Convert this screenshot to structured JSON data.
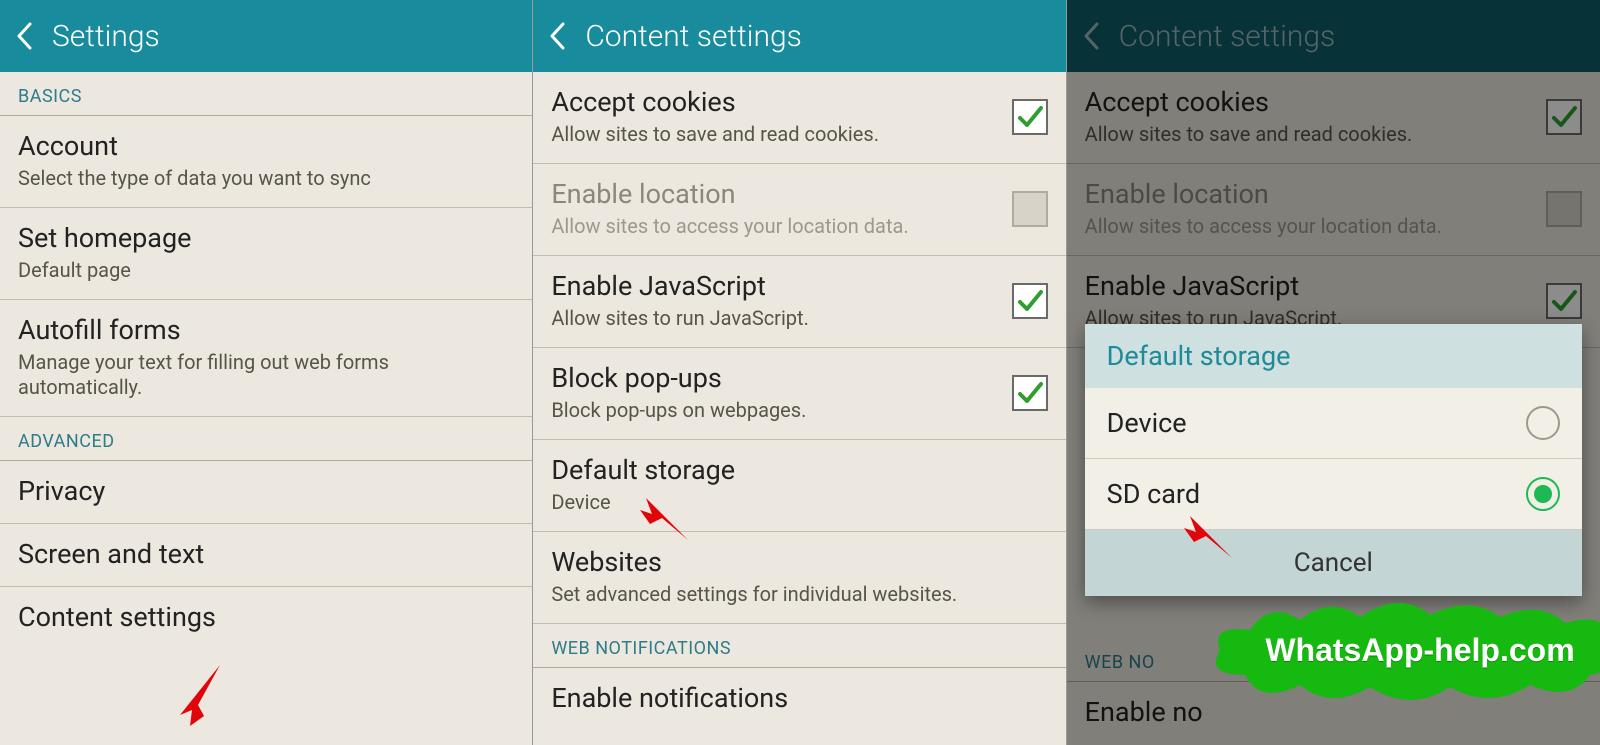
{
  "pane1": {
    "header": "Settings",
    "basics_label": "BASICS",
    "advanced_label": "ADVANCED",
    "account": {
      "title": "Account",
      "sub": "Select the type of data you want to sync"
    },
    "homepage": {
      "title": "Set homepage",
      "sub": "Default page"
    },
    "autofill": {
      "title": "Autofill forms",
      "sub": "Manage your text for filling out web forms automatically."
    },
    "privacy": {
      "title": "Privacy"
    },
    "screen_text": {
      "title": "Screen and text"
    },
    "content_settings": {
      "title": "Content settings"
    }
  },
  "pane2": {
    "header": "Content settings",
    "cookies": {
      "title": "Accept cookies",
      "sub": "Allow sites to save and read cookies.",
      "checked": true
    },
    "location": {
      "title": "Enable location",
      "sub": "Allow sites to access your location data.",
      "checked": false,
      "disabled": true
    },
    "js": {
      "title": "Enable JavaScript",
      "sub": "Allow sites to run JavaScript.",
      "checked": true
    },
    "popups": {
      "title": "Block pop-ups",
      "sub": "Block pop-ups on webpages.",
      "checked": true
    },
    "storage": {
      "title": "Default storage",
      "sub": "Device"
    },
    "websites": {
      "title": "Websites",
      "sub": "Set advanced settings for individual websites."
    },
    "web_notif_label": "WEB NOTIFICATIONS",
    "enable_notif": {
      "title": "Enable notifications"
    }
  },
  "pane3": {
    "header": "Content settings",
    "cookies": {
      "title": "Accept cookies",
      "sub": "Allow sites to save and read cookies."
    },
    "location": {
      "title": "Enable location",
      "sub": "Allow sites to access your location data."
    },
    "js": {
      "title": "Enable JavaScript",
      "sub": "Allow sites to run JavaScript."
    },
    "dialog": {
      "title": "Default storage",
      "opt1": "Device",
      "opt2": "SD card",
      "cancel": "Cancel"
    },
    "web_notif_label_partial": "WEB NO",
    "enable_notif_partial": "Enable no"
  },
  "watermark": "WhatsApp-help.com"
}
